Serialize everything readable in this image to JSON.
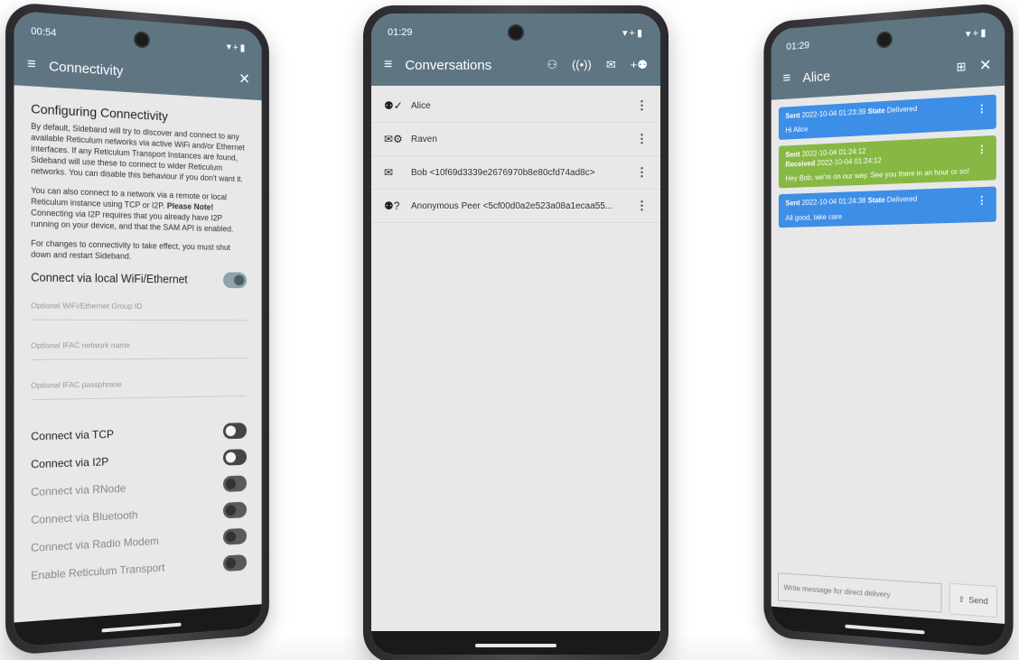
{
  "phone1": {
    "time": "00:54",
    "status_icons": "▾+▮",
    "title": "Connectivity",
    "heading": "Configuring Connectivity",
    "para1": "By default, Sideband will try to discover and connect to any available Reticulum networks via active WiFi and/or Ethernet interfaces. If any Reticulum Transport Instances are found, Sideband will use these to connect to wider Reticulum networks. You can disable this behaviour if you don't want it.",
    "para2_a": "You can also connect to a network via a remote or local Reticulum instance using TCP or I2P.",
    "para2_note": "Please Note!",
    "para2_b": "Connecting via I2P requires that you already have I2P running on your device, and that the SAM API is enabled.",
    "para3": "For changes to connectivity to take effect, you must shut down and restart Sideband.",
    "local_label": "Connect via local WiFi/Ethernet",
    "fields": [
      "Optional WiFi/Ethernet Group ID",
      "Optional IFAC network name",
      "Optional IFAC passphrase"
    ],
    "options": [
      {
        "label": "Connect via TCP"
      },
      {
        "label": "Connect via I2P"
      },
      {
        "label": "Connect via RNode"
      },
      {
        "label": "Connect via Bluetooth"
      },
      {
        "label": "Connect via Radio Modem"
      },
      {
        "label": "Enable Reticulum Transport"
      }
    ]
  },
  "phone2": {
    "time": "01:29",
    "status_icons": "▾+▮",
    "title": "Conversations",
    "conversations": [
      {
        "icon": "person-check-icon",
        "name": "Alice"
      },
      {
        "icon": "mail-settings-icon",
        "name": "Raven"
      },
      {
        "icon": "envelope-icon",
        "name": "Bob <10f69d3339e2676970b8e80cfd74ad8c>"
      },
      {
        "icon": "person-unknown-icon",
        "name": "Anonymous Peer <5cf00d0a2e523a08a1ecaa55..."
      }
    ]
  },
  "phone3": {
    "time": "01:29",
    "status_icons": "▾+▮",
    "title": "Alice",
    "messages": [
      {
        "color": "blue",
        "l1a": "Sent",
        "l1b": "2022-10-04 01:23:39",
        "l1c": "State",
        "l1d": "Delivered",
        "body": "Hi Alice"
      },
      {
        "color": "green",
        "l1a": "Sent",
        "l1b": "2022-10-04 01:24:12",
        "l2a": "Received",
        "l2b": "2022-10-04 01:24:12",
        "body": "Hey Bob, we're on our way. See you there in an hour or so!"
      },
      {
        "color": "blue",
        "l1a": "Sent",
        "l1b": "2022-10-04 01:24:38",
        "l1c": "State",
        "l1d": "Delivered",
        "body": "All good, take care"
      }
    ],
    "placeholder": "Write message for direct delivery",
    "send_label": "Send"
  },
  "colors": {
    "appbar": "#5f7682",
    "sent": "#3d8ee6",
    "received": "#86b843"
  }
}
